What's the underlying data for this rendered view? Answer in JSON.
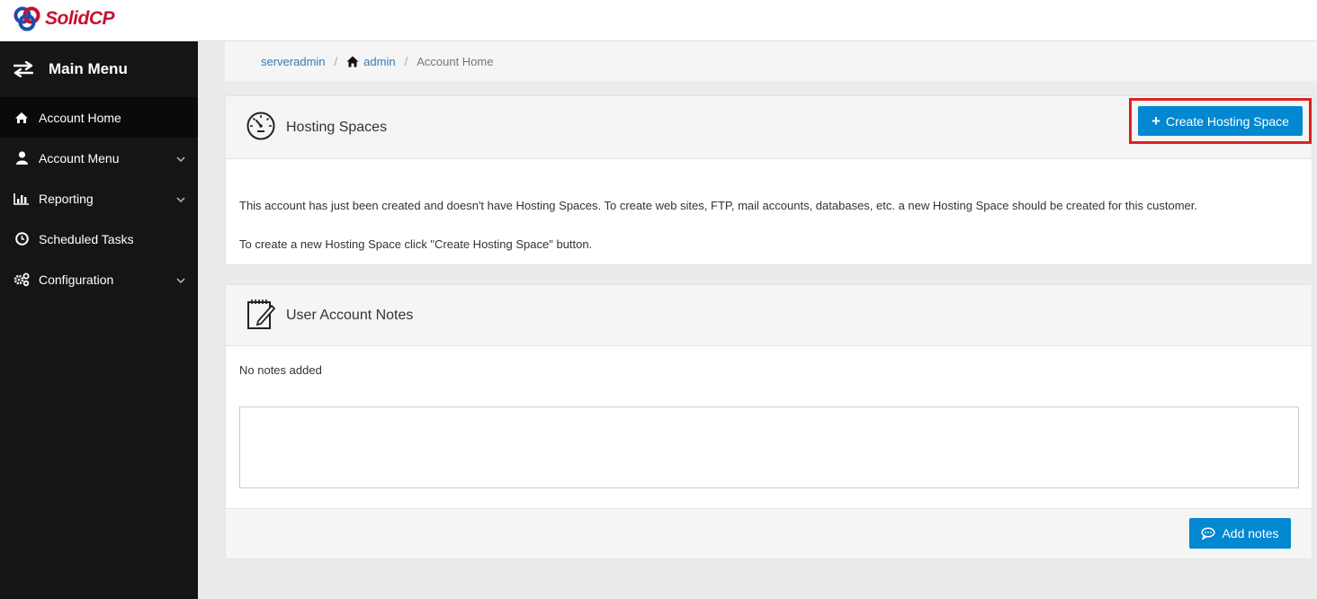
{
  "brand": {
    "name": "SolidCP"
  },
  "sidebar": {
    "title": "Main Menu",
    "items": [
      {
        "label": "Account Home",
        "icon": "home-icon",
        "active": true,
        "has_submenu": false
      },
      {
        "label": "Account Menu",
        "icon": "user-icon",
        "active": false,
        "has_submenu": true
      },
      {
        "label": "Reporting",
        "icon": "bar-chart-icon",
        "active": false,
        "has_submenu": true
      },
      {
        "label": "Scheduled Tasks",
        "icon": "clock-icon",
        "active": false,
        "has_submenu": false
      },
      {
        "label": "Configuration",
        "icon": "gears-icon",
        "active": false,
        "has_submenu": true
      }
    ]
  },
  "breadcrumb": {
    "items": [
      "serveradmin",
      "admin",
      "Account Home"
    ]
  },
  "hosting_spaces": {
    "title": "Hosting Spaces",
    "create_button": "Create Hosting Space",
    "message_1": "This account has just been created and doesn't have Hosting Spaces. To create web sites, FTP, mail accounts, databases, etc. a new Hosting Space should be created for this customer.",
    "message_2": "To create a new Hosting Space click \"Create Hosting Space\" button."
  },
  "notes": {
    "title": "User Account Notes",
    "empty_text": "No notes added",
    "textarea_value": "",
    "add_button": "Add notes"
  },
  "colors": {
    "sidebar_bg": "#151515",
    "primary": "#0288d1",
    "highlight": "#e02020",
    "brand": "#c8102e",
    "link": "#337ab7"
  }
}
